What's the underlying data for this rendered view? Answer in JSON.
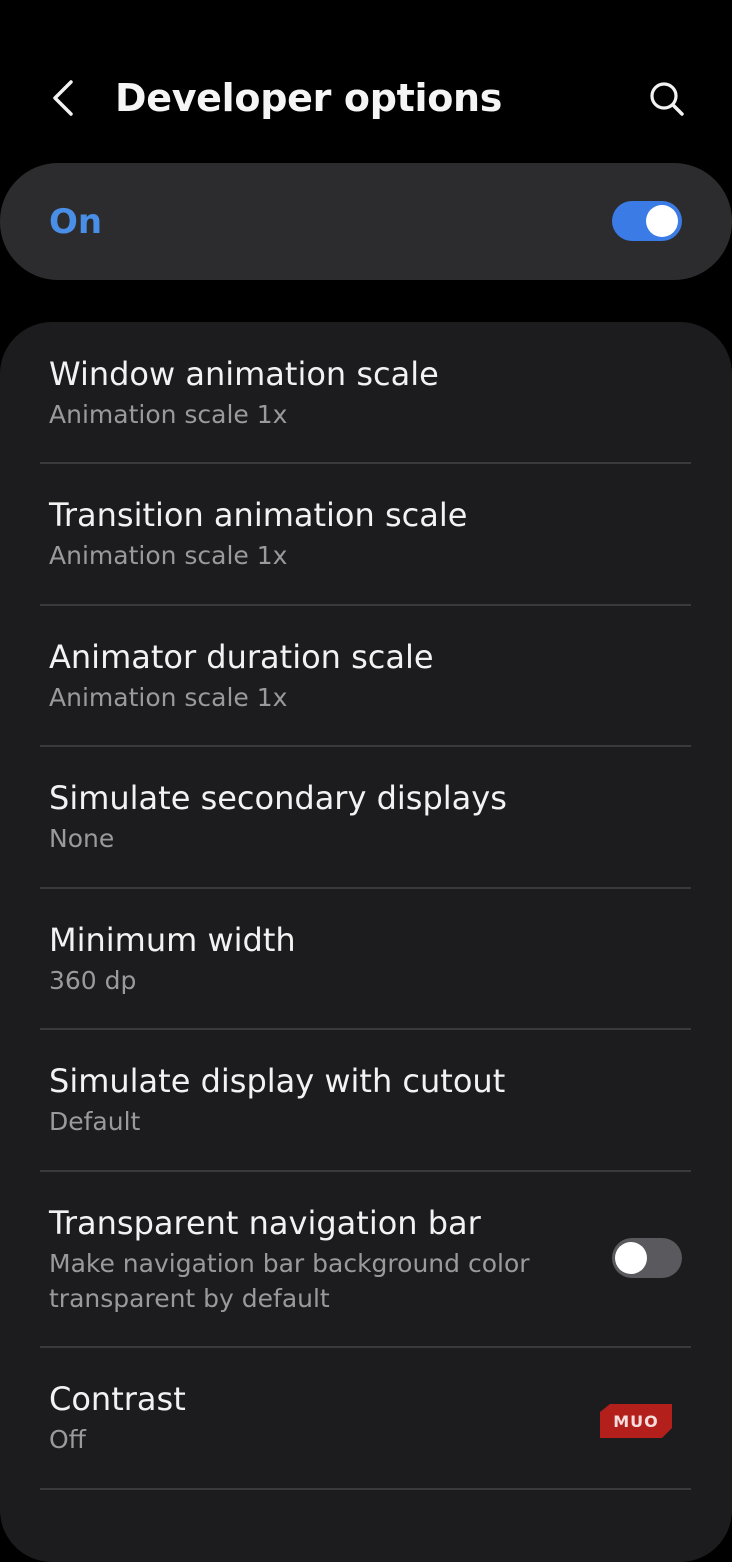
{
  "header": {
    "title": "Developer options",
    "back_icon": "chevron-left-icon",
    "search_icon": "search-icon"
  },
  "master": {
    "label": "On",
    "enabled": true,
    "label_color": "#4a8fe7",
    "toggle_color": "#3b7be5"
  },
  "items": [
    {
      "title": "Window animation scale",
      "subtitle": "Animation scale 1x"
    },
    {
      "title": "Transition animation scale",
      "subtitle": "Animation scale 1x"
    },
    {
      "title": "Animator duration scale",
      "subtitle": "Animation scale 1x"
    },
    {
      "title": "Simulate secondary displays",
      "subtitle": "None"
    },
    {
      "title": "Minimum width",
      "subtitle": "360 dp"
    },
    {
      "title": "Simulate display with cutout",
      "subtitle": "Default"
    },
    {
      "title": "Transparent navigation bar",
      "subtitle_line1": "Make navigation bar background color",
      "subtitle_line2": "transparent by default",
      "toggle": false
    },
    {
      "title": "Contrast",
      "subtitle": "Off"
    }
  ],
  "watermark": {
    "text": "MUO",
    "color": "#b3201c"
  },
  "colors": {
    "background": "#000000",
    "card": "#1c1c1e",
    "master_card": "#2c2c2e",
    "subtitle": "#9a9a9e"
  }
}
